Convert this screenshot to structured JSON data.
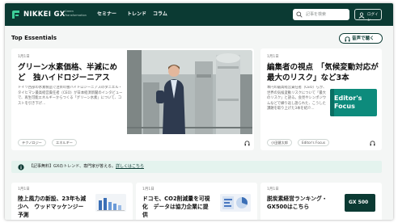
{
  "header": {
    "logo_text": "NIKKEI GX",
    "logo_sub": "Green Transformation",
    "nav": [
      "セミナー",
      "トレンド",
      "コラム"
    ],
    "search_placeholder": "記事を検索",
    "login_label": "ログイン"
  },
  "section": {
    "title": "Top Essentials",
    "listen_label": "音声で聴く"
  },
  "main_card": {
    "date": "1月1日",
    "headline": "グリーン水素価格、半減にめど　独ハイドロジーニアス",
    "summary": "ドイツ西部の水素製造で注目の独ハイドロジーニアスのダニエル・タイヒマン最高経営責任者（CEO）が日本経済新聞のインタビューで、再生可能エネルギーからつくる「グリーン水素」について、コストを引き下げ…",
    "tags": [
      "テクノロジー",
      "エネルギー"
    ]
  },
  "side_card": {
    "date": "1月1日",
    "headline": "編集者の視点　「気候変動対応が最大のリスク」など3本",
    "summary": "本円の最高経営責任者（CEO）らが、世界の気候変動リスクについて「最大のリスク」と語る。会見やシンポジウムなどで繰り返し語られた、こうした課題を取り上げた3本を紹介…",
    "tags": [
      "小田健太郎",
      "Editor's Focus"
    ],
    "badge_line1": "Editor's",
    "badge_line2": "Focus"
  },
  "banner": {
    "text": "【記事無料】GXのトレンド、専門家が答える。",
    "link": "詳しくはこちら"
  },
  "bottom_cards": [
    {
      "date": "1月1日",
      "headline": "陸上風力の新設、23年も減少へ　ウッドマッケンジー予測"
    },
    {
      "date": "1月1日",
      "headline": "ドコモ、CO2削減量を可視化　データは協力企業に提供"
    },
    {
      "date": "1月1日",
      "headline": "脱炭素経営ランキング・GX500はこちら",
      "thumb_label": "GX 500"
    }
  ]
}
